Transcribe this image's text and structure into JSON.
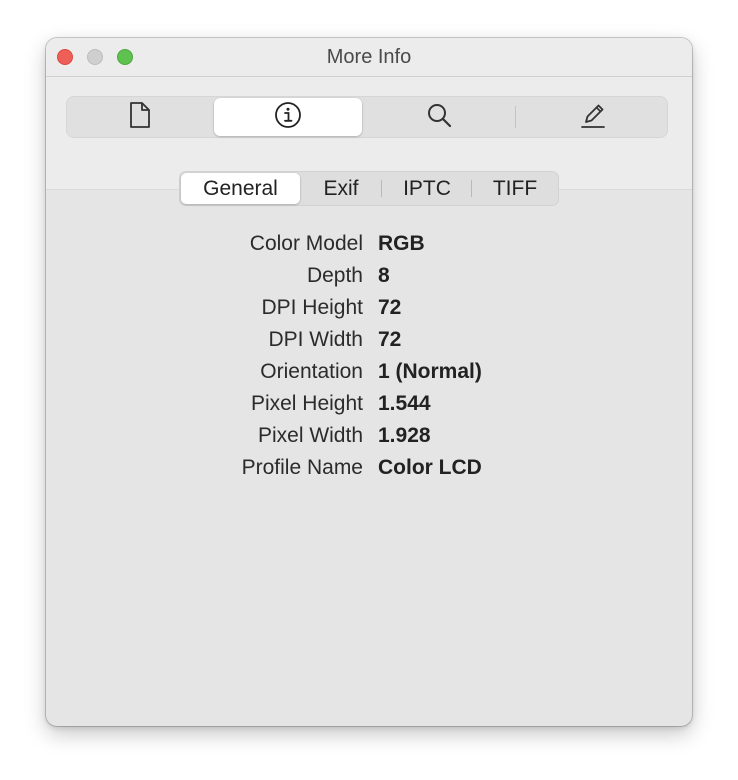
{
  "window": {
    "title": "More Info"
  },
  "toolbar": {
    "buttons": [
      {
        "icon": "document-icon",
        "selected": false
      },
      {
        "icon": "info-icon",
        "selected": true
      },
      {
        "icon": "search-icon",
        "selected": false
      },
      {
        "icon": "pencil-icon",
        "selected": false
      }
    ]
  },
  "subtabs": [
    {
      "label": "General",
      "selected": true
    },
    {
      "label": "Exif",
      "selected": false
    },
    {
      "label": "IPTC",
      "selected": false
    },
    {
      "label": "TIFF",
      "selected": false
    }
  ],
  "properties": [
    {
      "key": "Color Model",
      "value": "RGB"
    },
    {
      "key": "Depth",
      "value": "8"
    },
    {
      "key": "DPI Height",
      "value": "72"
    },
    {
      "key": "DPI Width",
      "value": "72"
    },
    {
      "key": "Orientation",
      "value": "1 (Normal)"
    },
    {
      "key": "Pixel Height",
      "value": "1.544"
    },
    {
      "key": "Pixel Width",
      "value": "1.928"
    },
    {
      "key": "Profile Name",
      "value": "Color LCD"
    }
  ]
}
